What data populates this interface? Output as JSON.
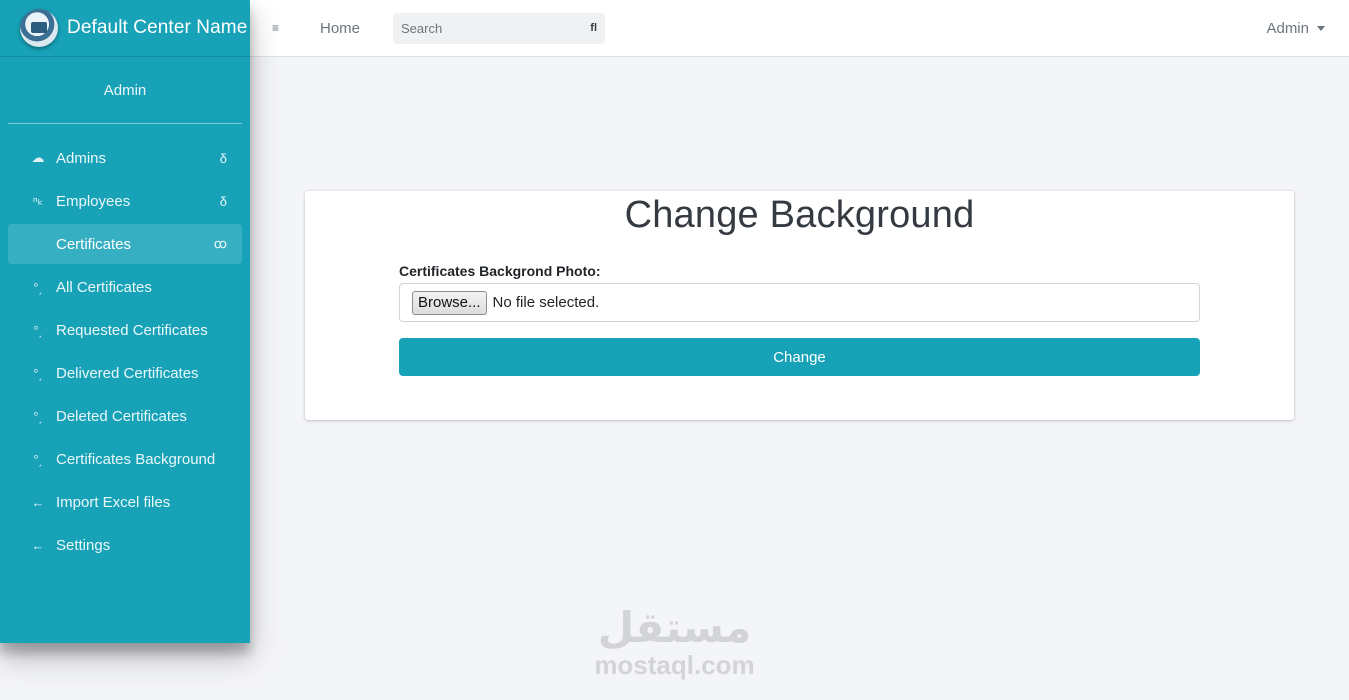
{
  "brand": {
    "name": "Default Center Name"
  },
  "user": {
    "name": "Admin"
  },
  "sidebar": {
    "items": [
      {
        "label": "Admins",
        "icon": "users-icon",
        "glyph": "☁",
        "arrow": "δ"
      },
      {
        "label": "Employees",
        "icon": "employees-icon",
        "glyph": "ⁿₖ",
        "arrow": "δ"
      },
      {
        "label": "Certificates",
        "icon": "",
        "glyph": "",
        "arrow": "ꝏ"
      },
      {
        "label": "All Certificates",
        "icon": "circle-icon",
        "glyph": "°͵",
        "arrow": ""
      },
      {
        "label": "Requested Certificates",
        "icon": "circle-icon",
        "glyph": "°͵",
        "arrow": ""
      },
      {
        "label": "Delivered Certificates",
        "icon": "circle-icon",
        "glyph": "°͵",
        "arrow": ""
      },
      {
        "label": "Deleted Certificates",
        "icon": "circle-icon",
        "glyph": "°͵",
        "arrow": ""
      },
      {
        "label": "Certificates Background",
        "icon": "circle-icon",
        "glyph": "°͵",
        "arrow": ""
      },
      {
        "label": "Import Excel files",
        "icon": "arrow-left-icon",
        "glyph": "←",
        "arrow": ""
      },
      {
        "label": "Settings",
        "icon": "arrow-left-icon",
        "glyph": "←",
        "arrow": ""
      }
    ]
  },
  "topbar": {
    "menu_glyph": "≡",
    "home_label": "Home",
    "search_placeholder": "Search",
    "search_glyph": "fl",
    "admin_label": "Admin"
  },
  "card": {
    "title": "Change Background",
    "field_label": "Certificates Backgrond Photo:",
    "browse_label": "Browse...",
    "file_status": "No file selected.",
    "submit_label": "Change"
  },
  "watermark": {
    "arabic": "مستقل",
    "latin": "mostaql.com"
  },
  "colors": {
    "accent": "#17a2b8",
    "background": "#f4f5f9"
  }
}
